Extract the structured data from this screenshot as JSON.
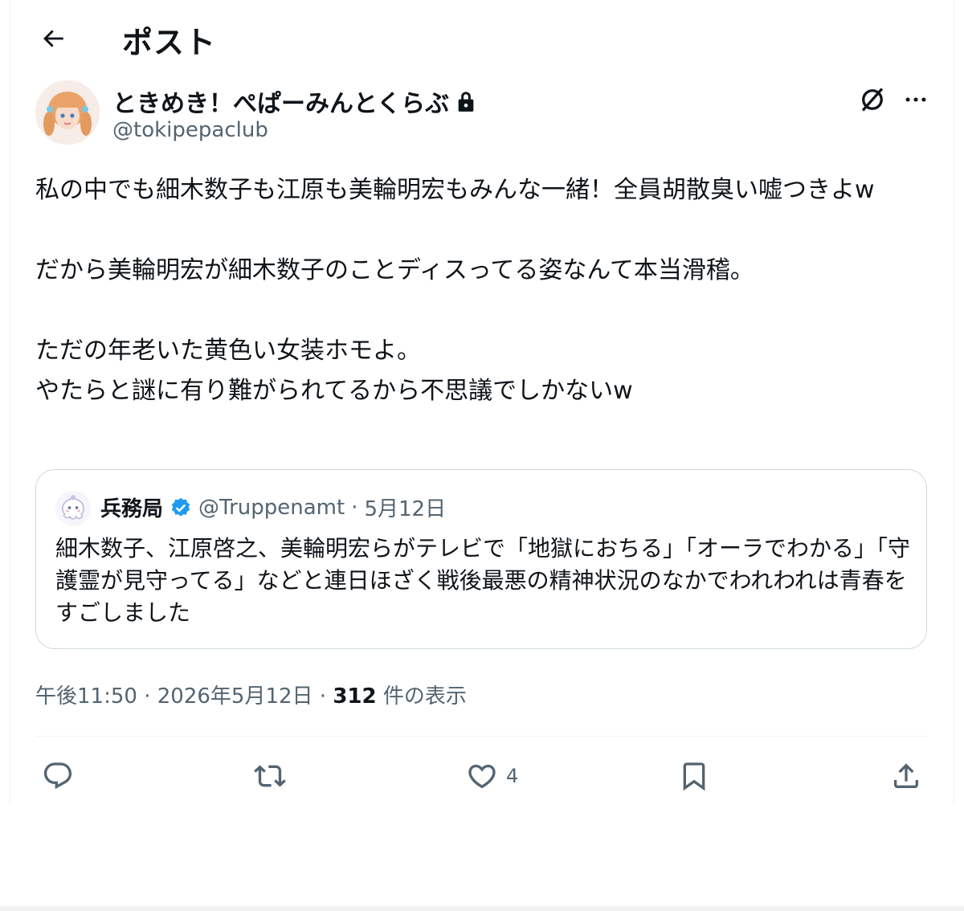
{
  "header": {
    "title": "ポスト",
    "back_icon": "arrow-left-icon"
  },
  "author": {
    "display_name": "ときめき！ぺぱーみんとくらぶ",
    "handle": "@tokipepaclub",
    "protected_icon": "lock-icon"
  },
  "post": {
    "paragraphs": [
      [
        "私の中でも細木数子も江原も美輪明宏もみんな一緒！全員胡散臭い嘘つきよw"
      ],
      [
        "だから美輪明宏が細木数子のことディスってる姿なんて本当滑稽。"
      ],
      [
        "ただの年老いた黄色い女装ホモよ。",
        "やたらと謎に有り難がられてるから不思議でしかないw"
      ]
    ]
  },
  "quote": {
    "name": "兵務局",
    "verified_icon": "verified-badge-icon",
    "handle": "@Truppenamt",
    "separator": "·",
    "date": "5月12日",
    "text": "細木数子、江原啓之、美輪明宏らがテレビで「地獄におちる」「オーラでわかる」「守護霊が見守ってる」などと連日ほざく戦後最悪の精神状況のなかでわれわれは青春をすごしました"
  },
  "meta": {
    "time": "午後11:50",
    "sep1": "·",
    "date": "2026年5月12日",
    "sep2": "·",
    "views": "312",
    "views_label": "件の表示"
  },
  "actions": {
    "reply_icon": "reply-icon",
    "repost_icon": "repost-icon",
    "like_icon": "heart-icon",
    "like_count": "4",
    "bookmark_icon": "bookmark-icon",
    "share_icon": "share-icon"
  },
  "colors": {
    "text": "#0f1419",
    "secondary": "#536471",
    "border": "#cfd9de",
    "verified": "#1d9bf0"
  }
}
